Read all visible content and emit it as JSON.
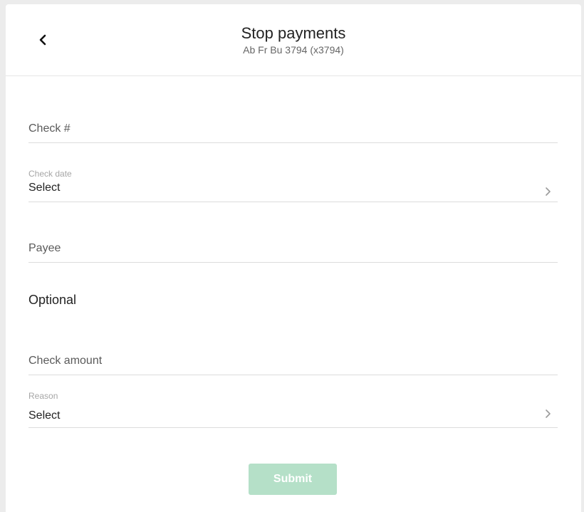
{
  "header": {
    "title": "Stop payments",
    "subtitle": "Ab Fr Bu 3794 (x3794)"
  },
  "form": {
    "check_number": {
      "placeholder": "Check #",
      "value": ""
    },
    "check_date": {
      "label": "Check date",
      "value": "Select"
    },
    "payee": {
      "placeholder": "Payee",
      "value": ""
    },
    "optional_heading": "Optional",
    "check_amount": {
      "placeholder": "Check amount",
      "value": ""
    },
    "reason": {
      "label": "Reason",
      "value": "Select"
    }
  },
  "actions": {
    "submit_label": "Submit"
  },
  "icons": {
    "back": "chevron-left-icon",
    "select": "chevron-right-icon"
  },
  "colors": {
    "submit_disabled_bg": "#b5e0c8",
    "divider": "#dcdcdc",
    "page_bg": "#ececec"
  }
}
